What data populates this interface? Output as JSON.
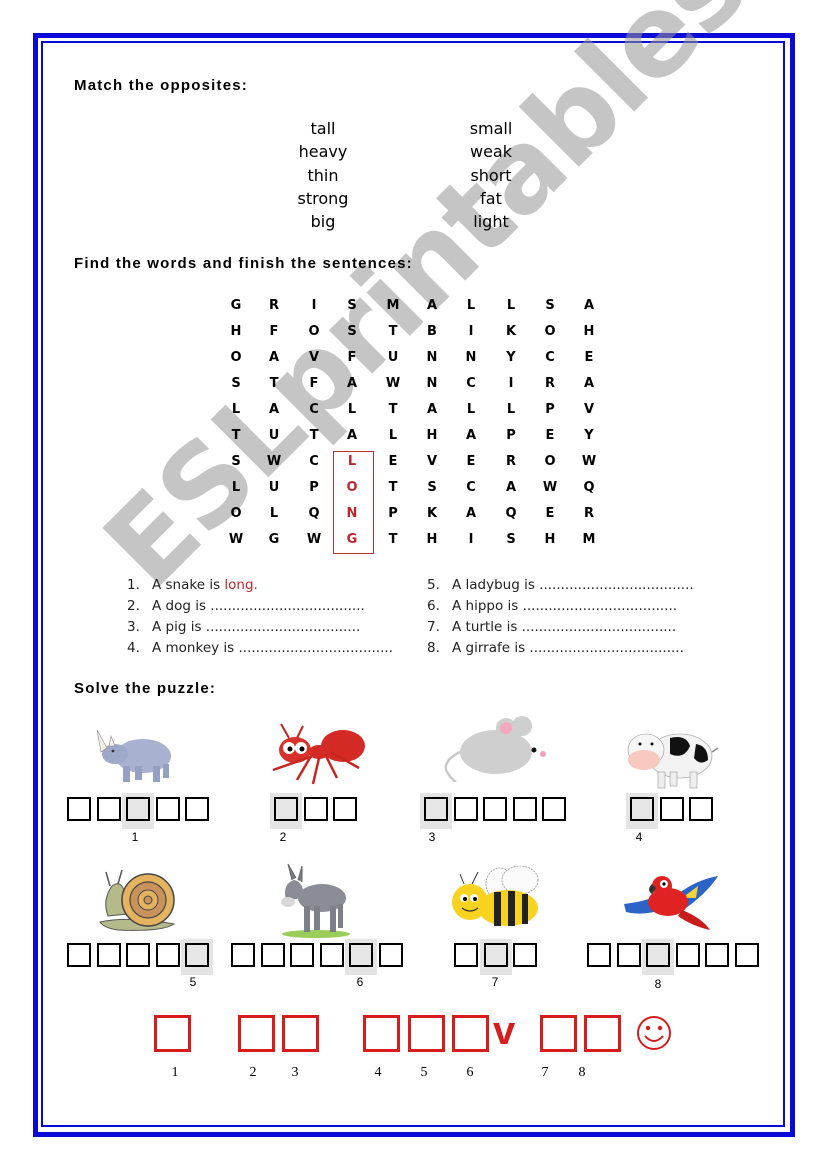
{
  "sections": {
    "match_heading": "Match the opposites:",
    "find_heading": "Find the words and finish the sentences:",
    "puzzle_heading": "Solve the puzzle:"
  },
  "opposites": {
    "left": [
      "tall",
      "heavy",
      "thin",
      "strong",
      "big"
    ],
    "right": [
      "small",
      "weak",
      "short",
      "fat",
      "light"
    ]
  },
  "word_search": {
    "rows": [
      [
        "G",
        "R",
        "I",
        "S",
        "M",
        "A",
        "L",
        "L",
        "S",
        "A"
      ],
      [
        "H",
        "F",
        "O",
        "S",
        "T",
        "B",
        "I",
        "K",
        "O",
        "H"
      ],
      [
        "O",
        "A",
        "V",
        "F",
        "U",
        "N",
        "N",
        "Y",
        "C",
        "E"
      ],
      [
        "S",
        "T",
        "F",
        "A",
        "W",
        "N",
        "C",
        "I",
        "R",
        "A"
      ],
      [
        "L",
        "A",
        "C",
        "L",
        "T",
        "A",
        "L",
        "L",
        "P",
        "V"
      ],
      [
        "T",
        "U",
        "T",
        "A",
        "L",
        "H",
        "A",
        "P",
        "E",
        "Y"
      ],
      [
        "S",
        "W",
        "C",
        "L",
        "E",
        "V",
        "E",
        "R",
        "O",
        "W"
      ],
      [
        "L",
        "U",
        "P",
        "O",
        "T",
        "S",
        "C",
        "A",
        "W",
        "Q"
      ],
      [
        "O",
        "L",
        "Q",
        "N",
        "P",
        "K",
        "A",
        "Q",
        "E",
        "R"
      ],
      [
        "W",
        "G",
        "W",
        "G",
        "T",
        "H",
        "I",
        "S",
        "H",
        "M"
      ]
    ],
    "found_word": "LONG",
    "highlight_color": "#c0262c"
  },
  "sentences": [
    {
      "num": "1.",
      "text": "A snake is ",
      "answer": "long."
    },
    {
      "num": "2.",
      "text": "A dog is ....................................",
      "answer": ""
    },
    {
      "num": "3.",
      "text": "A pig is ....................................",
      "answer": ""
    },
    {
      "num": "4.",
      "text": "A monkey is ....................................",
      "answer": ""
    },
    {
      "num": "5.",
      "text": "A ladybug is ....................................",
      "answer": ""
    },
    {
      "num": "6.",
      "text": "A hippo is ....................................",
      "answer": ""
    },
    {
      "num": "7.",
      "text": "A turtle is ....................................",
      "answer": ""
    },
    {
      "num": "8.",
      "text": "A girrafe is ....................................",
      "answer": ""
    }
  ],
  "puzzle": {
    "animals": [
      {
        "name": "rhino",
        "letters": 5,
        "highlight_index": 3,
        "number": "1"
      },
      {
        "name": "ant",
        "letters": 3,
        "highlight_index": 1,
        "number": "2"
      },
      {
        "name": "mouse",
        "letters": 5,
        "highlight_index": 1,
        "number": "3"
      },
      {
        "name": "cow",
        "letters": 3,
        "highlight_index": 1,
        "number": "4"
      },
      {
        "name": "snail",
        "letters": 5,
        "highlight_index": 5,
        "number": "5"
      },
      {
        "name": "donkey",
        "letters": 6,
        "highlight_index": 5,
        "number": "6"
      },
      {
        "name": "bee",
        "letters": 3,
        "highlight_index": 2,
        "number": "7"
      },
      {
        "name": "parrot",
        "letters": 6,
        "highlight_index": 3,
        "number": "8"
      }
    ],
    "final_numbers": [
      "1",
      "2",
      "3",
      "4",
      "5",
      "6",
      "7",
      "8"
    ],
    "final_given_letter": "v",
    "final_color": "#d61c1c"
  },
  "watermark": "ESLprintables.com",
  "colors": {
    "border": "#0a0ad8",
    "answer": "#c0262c"
  }
}
